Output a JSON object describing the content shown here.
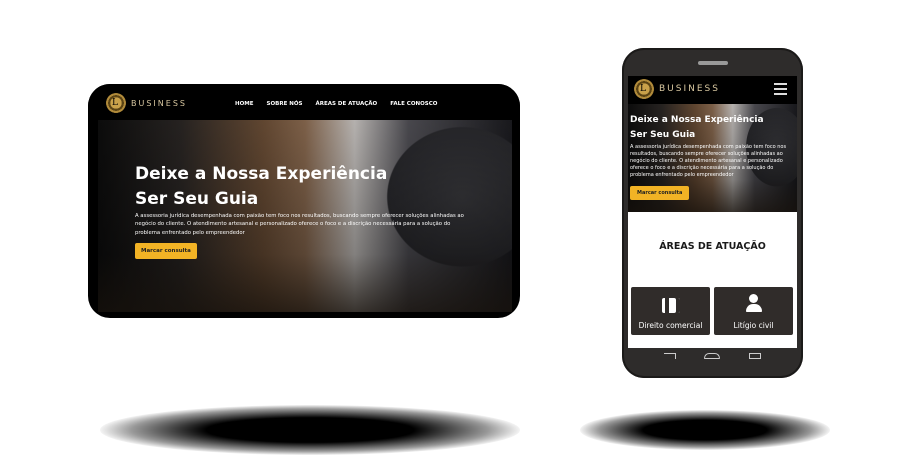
{
  "brand": {
    "logo_letter": "L",
    "name": "BUSINESS"
  },
  "nav": {
    "items": [
      "HOME",
      "SOBRE NÓS",
      "ÁREAS DE ATUAÇÃO",
      "FALE CONOSCO"
    ]
  },
  "hero": {
    "title_line1": "Deixe a Nossa Experiência",
    "title_line2": "Ser Seu Guia",
    "description": "A assessoria jurídica desempenhada com paixão tem foco nos resultados, buscando sempre oferecer soluções alinhadas ao negócio do cliente. O atendimento artesanal e personalizado oferece o foco e a discrição necessária para a solução do problema enfrentado pelo empreendedor",
    "cta": "Marcar consulta"
  },
  "mobile": {
    "section_title": "ÁREAS DE ATUAÇÃO",
    "cards": [
      {
        "icon": "briefcase-icon",
        "label": "Direito comercial"
      },
      {
        "icon": "user-icon",
        "label": "Litígio civil"
      }
    ]
  },
  "colors": {
    "accent": "#f2b325",
    "gold": "#c9a14a",
    "card": "#302c2a"
  }
}
